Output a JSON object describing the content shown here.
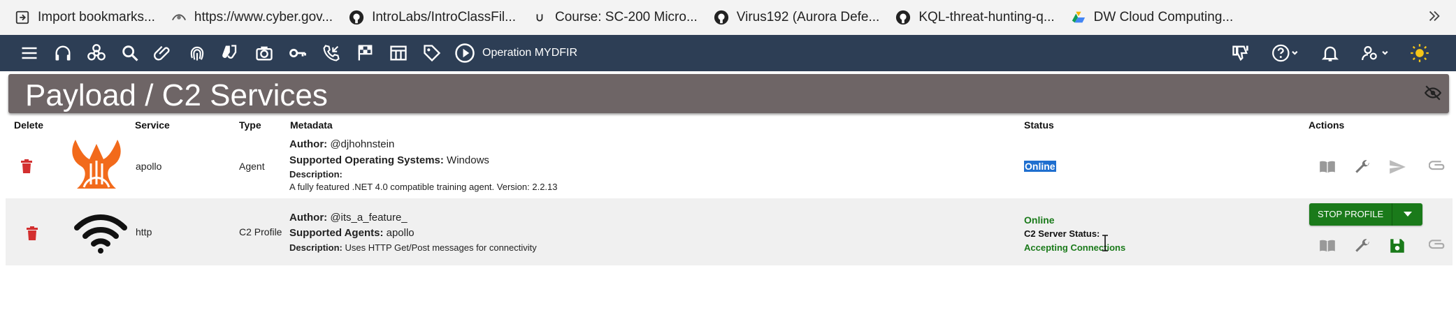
{
  "bookmarks": [
    {
      "label": "Import bookmarks...",
      "icon": "import-icon"
    },
    {
      "label": "https://www.cyber.gov...",
      "icon": "gov-crest-icon"
    },
    {
      "label": "IntroLabs/IntroClassFil...",
      "icon": "github-icon"
    },
    {
      "label": "Course: SC-200 Micro...",
      "icon": "course-icon"
    },
    {
      "label": "Virus192 (Aurora Defe...",
      "icon": "github-icon"
    },
    {
      "label": "KQL-threat-hunting-q...",
      "icon": "github-icon"
    },
    {
      "label": "DW Cloud Computing...",
      "icon": "google-drive-icon"
    }
  ],
  "toolbar": {
    "operation": "Operation MYDFIR"
  },
  "page": {
    "title": "Payload / C2 Services"
  },
  "table": {
    "headers": {
      "delete": "Delete",
      "service": "Service",
      "type": "Type",
      "metadata": "Metadata",
      "status": "Status",
      "actions": "Actions"
    },
    "rows": [
      {
        "service": "apollo",
        "type": "Agent",
        "author_label": "Author:",
        "author": "@djhohnstein",
        "os_label": "Supported Operating Systems:",
        "os": "Windows",
        "desc_label": "Description:",
        "description": "A fully featured .NET 4.0 compatible training agent. Version: 2.2.13",
        "status": "Online"
      },
      {
        "service": "http",
        "type": "C2 Profile",
        "author_label": "Author:",
        "author": "@its_a_feature_",
        "agents_label": "Supported Agents:",
        "agents": "apollo",
        "desc_label": "Description:",
        "description": "Uses HTTP Get/Post messages for connectivity",
        "status": "Online",
        "c2_label": "C2 Server Status:",
        "c2_status": "Accepting Connections",
        "stop_label": "STOP PROFILE"
      }
    ]
  },
  "colors": {
    "toolbar_bg": "#2d3e55",
    "title_bg": "#6e6566",
    "online_green": "#1a7a1a",
    "delete_red": "#d32f2f",
    "apollo_orange": "#f26a1b"
  }
}
